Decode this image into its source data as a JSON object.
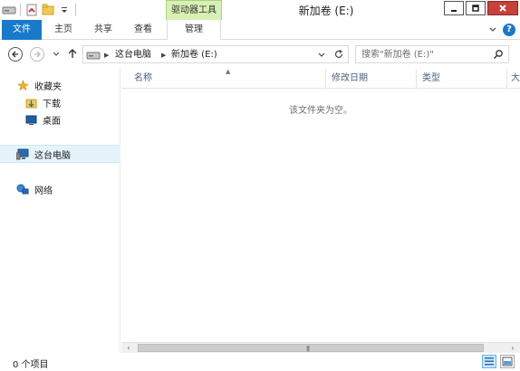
{
  "window": {
    "title": "新加卷 (E:)",
    "context_tab_group": "驱动器工具"
  },
  "ribbon": {
    "tabs": [
      {
        "label": "文件",
        "active": true
      },
      {
        "label": "主页"
      },
      {
        "label": "共享"
      },
      {
        "label": "查看"
      },
      {
        "label": "管理"
      }
    ]
  },
  "address_bar": {
    "crumbs": [
      "这台电脑",
      "新加卷 (E:)"
    ]
  },
  "search": {
    "placeholder": "搜索\"新加卷 (E:)\""
  },
  "nav_pane": {
    "favorites_label": "收藏夹",
    "favorites": [
      "下载",
      "桌面"
    ],
    "this_pc_label": "这台电脑",
    "network_label": "网络"
  },
  "columns": [
    "名称",
    "修改日期",
    "类型",
    "大"
  ],
  "empty_message": "该文件夹为空。",
  "status": {
    "item_count": "0 个项目"
  },
  "colors": {
    "file_tab": "#1979ca",
    "context_tab": "#d9f0b4",
    "close_button": "#c7403a",
    "selected_nav": "#e5f3fb"
  },
  "icons": {
    "qat": [
      "drive-icon",
      "properties-icon",
      "new-folder-icon",
      "customize-qat-icon"
    ],
    "nav": [
      "back-icon",
      "forward-icon",
      "recent-locations-icon",
      "up-icon"
    ],
    "tree": [
      "star-icon",
      "downloads-folder-icon",
      "desktop-icon",
      "computer-icon",
      "network-icon"
    ]
  }
}
